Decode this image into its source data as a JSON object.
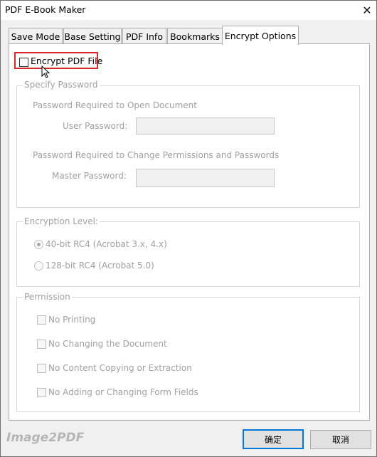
{
  "window": {
    "title": "PDF E-Book Maker",
    "close_glyph": "✕"
  },
  "tabs": [
    {
      "label": "Save Mode",
      "active": false
    },
    {
      "label": "Base Setting",
      "active": false
    },
    {
      "label": "PDF Info",
      "active": false
    },
    {
      "label": "Bookmarks",
      "active": false
    },
    {
      "label": "Encrypt Options",
      "active": true
    }
  ],
  "encrypt": {
    "label": "Encrypt PDF File",
    "checked": false,
    "highlight_color": "#d9262a"
  },
  "password_group": {
    "title": "Specify Password",
    "open_heading": "Password Required to Open Document",
    "user_label": "User Password:",
    "user_value": "",
    "perm_heading": "Password Required to Change Permissions and Passwords",
    "master_label": "Master Password:",
    "master_value": ""
  },
  "encryption_group": {
    "title": "Encryption Level:",
    "options": [
      {
        "label": "40-bit RC4 (Acrobat 3.x, 4.x)",
        "selected": true
      },
      {
        "label": "128-bit RC4 (Acrobat 5.0)",
        "selected": false
      }
    ]
  },
  "permission_group": {
    "title": "Permission",
    "items": [
      {
        "label": "No Printing",
        "checked": false
      },
      {
        "label": "No Changing the Document",
        "checked": false
      },
      {
        "label": "No Content Copying or Extraction",
        "checked": false
      },
      {
        "label": "No Adding or Changing Form Fields",
        "checked": false
      }
    ]
  },
  "footer": {
    "brand": "Image2PDF",
    "ok_label": "确定",
    "cancel_label": "取消"
  },
  "icons": {
    "cursor": "cursor-arrow-icon",
    "close": "close-icon"
  },
  "colors": {
    "default_button_border": "#0078d7",
    "disabled_text": "#a0a0a0"
  }
}
